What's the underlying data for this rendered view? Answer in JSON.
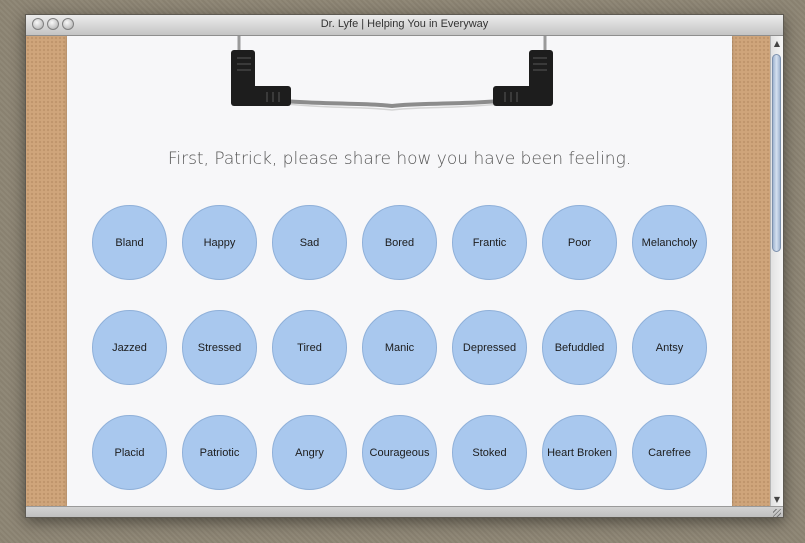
{
  "window": {
    "title": "Dr. Lyfe | Helping You in Everyway"
  },
  "question": "First, Patrick, please share how you have been feeling.",
  "feelings": [
    [
      "Bland",
      "Happy",
      "Sad",
      "Bored",
      "Frantic",
      "Poor",
      "Melancholy"
    ],
    [
      "Jazzed",
      "Stressed",
      "Tired",
      "Manic",
      "Depressed",
      "Befuddled",
      "Antsy"
    ],
    [
      "Placid",
      "Patriotic",
      "Angry",
      "Courageous",
      "Stoked",
      "Heart Broken",
      "Carefree"
    ]
  ],
  "colors": {
    "bubble": "#a9c8ee",
    "clipboard": "#cfa57b",
    "paper": "#f7f7f9"
  },
  "icons": {
    "scroll_up": "triangle-up",
    "scroll_down": "triangle-down"
  }
}
